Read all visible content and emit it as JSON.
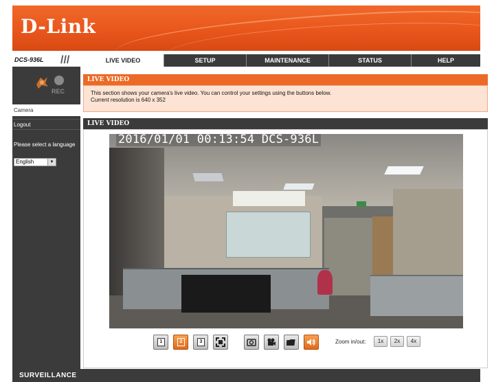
{
  "header": {
    "logo": "D-Link"
  },
  "model": "DCS-936L",
  "tabs": [
    {
      "label": "LIVE VIDEO",
      "active": true
    },
    {
      "label": "SETUP",
      "active": false
    },
    {
      "label": "MAINTENANCE",
      "active": false
    },
    {
      "label": "STATUS",
      "active": false
    },
    {
      "label": "HELP",
      "active": false
    }
  ],
  "sidebar": {
    "rec_label": "REC",
    "camera_link": "Camera",
    "logout_link": "Logout",
    "language_prompt": "Please select a language",
    "language_value": "English"
  },
  "info_section": {
    "title": "LIVE VIDEO",
    "line1": "This section shows your camera's live video. You can control your settings using the buttons below.",
    "line2": "Current resolution is 640 x 352"
  },
  "video_section": {
    "title": "LIVE VIDEO",
    "osd_text": "2016/01/01 00:13:54 DCS-936L"
  },
  "controls": {
    "profile_buttons": [
      "1",
      "2",
      "3"
    ],
    "active_profile": "2",
    "zoom_label": "Zoom in/out:",
    "zoom_options": [
      "1x",
      "2x",
      "4x"
    ]
  },
  "footer": {
    "text": "SURVEILLANCE"
  },
  "colors": {
    "brand_orange": "#ec6a26",
    "dark_gray": "#3b3b3b",
    "info_bg": "#fde3d3"
  }
}
